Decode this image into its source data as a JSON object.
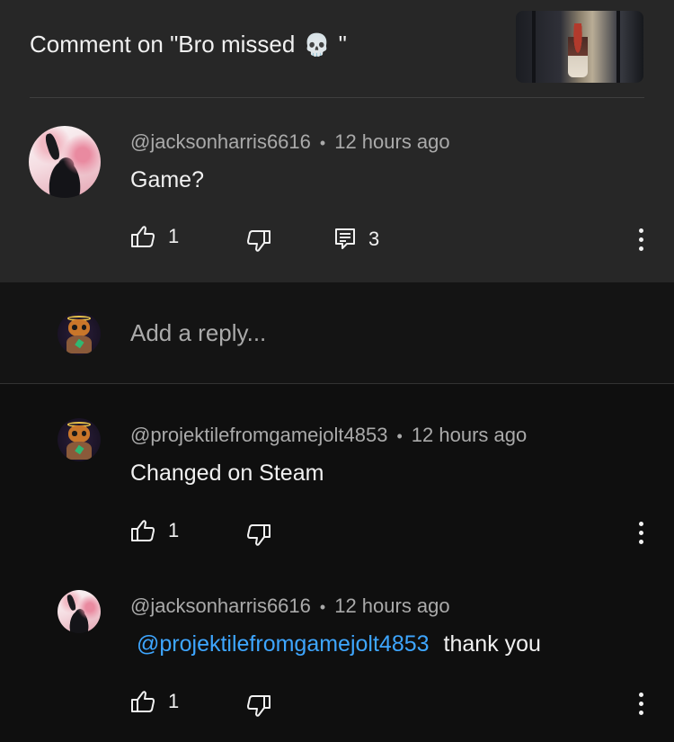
{
  "header": {
    "title_prefix": "Comment on \"Bro missed ",
    "title_emoji": "💀",
    "title_suffix": " \"",
    "thumbnail_alt": "video-thumbnail"
  },
  "parent_comment": {
    "author": "@jacksonharris6616",
    "time": "12 hours ago",
    "text": "Game?",
    "likes": "1",
    "replies": "3"
  },
  "reply_input": {
    "placeholder": "Add a reply..."
  },
  "replies": [
    {
      "author": "@projektilefromgamejolt4853",
      "time": "12 hours ago",
      "text": "Changed on Steam",
      "likes": "1"
    },
    {
      "author": "@jacksonharris6616",
      "time": "12 hours ago",
      "mention": "@projektilefromgamejolt4853",
      "text": "thank you",
      "likes": "1"
    }
  ],
  "separator": "•",
  "colors": {
    "background": "#0f0f0f",
    "panel": "#272727",
    "mention": "#3ea6ff",
    "muted": "#aaaaaa"
  },
  "icons": [
    "thumb-up-icon",
    "thumb-down-icon",
    "replies-icon",
    "more-vert-icon"
  ]
}
